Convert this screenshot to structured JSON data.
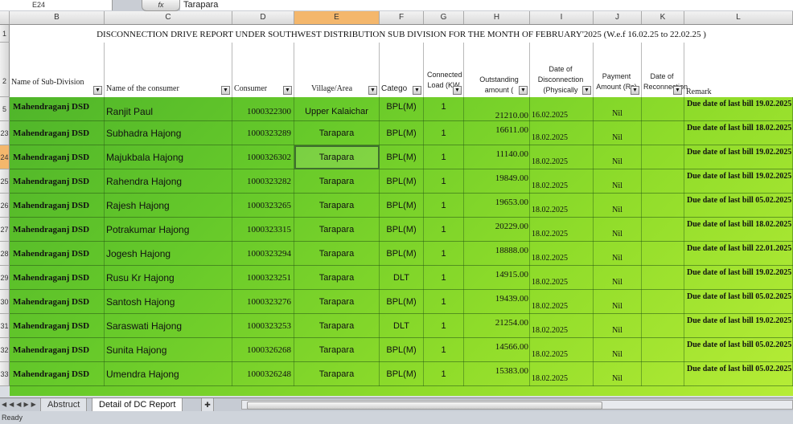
{
  "formula_bar": {
    "cell_ref": "E24",
    "fx": "fx",
    "content": "Tarapara"
  },
  "columns": [
    "B",
    "C",
    "D",
    "E",
    "F",
    "G",
    "H",
    "I",
    "J",
    "K",
    "L"
  ],
  "row_numbers": [
    "1",
    "2",
    "5",
    "23",
    "24",
    "25",
    "26",
    "27",
    "28",
    "29",
    "30",
    "31",
    "32",
    "33"
  ],
  "title": "DISCONNECTION DRIVE REPORT UNDER SOUTHWEST DISTRIBUTION SUB DIVISION FOR THE MONTH OF FEBRUARY'2025 (W.e.f 16.02.25 to 22.02.25 )",
  "headers": {
    "sub": "Name of Sub-Division",
    "name": "Name of the consumer",
    "consumer": "Consumer",
    "village": "Village/Area",
    "category": "Catego",
    "load": "Connected Load (KW",
    "outstanding": "Outstanding amount (",
    "date": "Date of Disconnection (Physically",
    "payment": "Payment Amount (Rs)",
    "reconn": "Date of Reconnection",
    "remark": "Remark"
  },
  "rows": [
    {
      "sub": "Mahendraganj DSD",
      "name": "Ranjit Paul",
      "consumer": "1000322300",
      "village": "Upper Kalaichar",
      "category": "BPL(M)",
      "load": "1",
      "amount": "21210.00",
      "date": "16.02.2025",
      "payment": "Nil",
      "remark": "Due date of last bill 19.02.2025"
    },
    {
      "sub": "Mahendraganj DSD",
      "name": "Subhadra Hajong",
      "consumer": "1000323289",
      "village": "Tarapara",
      "category": "BPL(M)",
      "load": "1",
      "amount": "16611.00",
      "date": "18.02.2025",
      "payment": "Nil",
      "remark": "Due date of last bill 18.02.2025"
    },
    {
      "sub": "Mahendraganj DSD",
      "name": "Majukbala Hajong",
      "consumer": "1000326302",
      "village": "Tarapara",
      "category": "BPL(M)",
      "load": "1",
      "amount": "11140.00",
      "date": "18.02.2025",
      "payment": "Nil",
      "remark": "Due date of last bill 19.02.2025"
    },
    {
      "sub": "Mahendraganj DSD",
      "name": "Rahendra Hajong",
      "consumer": "1000323282",
      "village": "Tarapara",
      "category": "BPL(M)",
      "load": "1",
      "amount": "19849.00",
      "date": "18.02.2025",
      "payment": "Nil",
      "remark": "Due date of last bill 19.02.2025"
    },
    {
      "sub": "Mahendraganj DSD",
      "name": "Rajesh Hajong",
      "consumer": "1000323265",
      "village": "Tarapara",
      "category": "BPL(M)",
      "load": "1",
      "amount": "19653.00",
      "date": "18.02.2025",
      "payment": "Nil",
      "remark": "Due date of last bill 05.02.2025"
    },
    {
      "sub": "Mahendraganj DSD",
      "name": "Potrakumar Hajong",
      "consumer": "1000323315",
      "village": "Tarapara",
      "category": "BPL(M)",
      "load": "1",
      "amount": "20229.00",
      "date": "18.02.2025",
      "payment": "Nil",
      "remark": "Due date of last bill 18.02.2025"
    },
    {
      "sub": "Mahendraganj DSD",
      "name": "Jogesh Hajong",
      "consumer": "1000323294",
      "village": "Tarapara",
      "category": "BPL(M)",
      "load": "1",
      "amount": "18888.00",
      "date": "18.02.2025",
      "payment": "Nil",
      "remark": "Due date of last bill 22.01.2025"
    },
    {
      "sub": "Mahendraganj DSD",
      "name": "Rusu Kr Hajong",
      "consumer": "1000323251",
      "village": "Tarapara",
      "category": "DLT",
      "load": "1",
      "amount": "14915.00",
      "date": "18.02.2025",
      "payment": "Nil",
      "remark": "Due date of last bill 19.02.2025"
    },
    {
      "sub": "Mahendraganj DSD",
      "name": "Santosh Hajong",
      "consumer": "1000323276",
      "village": "Tarapara",
      "category": "BPL(M)",
      "load": "1",
      "amount": "19439.00",
      "date": "18.02.2025",
      "payment": "Nil",
      "remark": "Due date of last bill 05.02.2025"
    },
    {
      "sub": "Mahendraganj DSD",
      "name": "Saraswati Hajong",
      "consumer": "1000323253",
      "village": "Tarapara",
      "category": "DLT",
      "load": "1",
      "amount": "21254.00",
      "date": "18.02.2025",
      "payment": "Nil",
      "remark": "Due date of last bill 19.02.2025"
    },
    {
      "sub": "Mahendraganj DSD",
      "name": "Sunita Hajong",
      "consumer": "1000326268",
      "village": "Tarapara",
      "category": "BPL(M)",
      "load": "1",
      "amount": "14566.00",
      "date": "18.02.2025",
      "payment": "Nil",
      "remark": "Due date of last bill 05.02.2025"
    },
    {
      "sub": "Mahendraganj DSD",
      "name": "Umendra Hajong",
      "consumer": "1000326248",
      "village": "Tarapara",
      "category": "BPL(M)",
      "load": "1",
      "amount": "15383.00",
      "date": "18.02.2025",
      "payment": "Nil",
      "remark": "Due date of last bill 05.02.2025"
    }
  ],
  "tabs": [
    {
      "label": "Abstruct",
      "active": false
    },
    {
      "label": "Detail of DC Report",
      "active": true
    }
  ],
  "status": "Ready",
  "colors": {
    "selected_header": "#f4b76c",
    "green_start": "#4fb52a",
    "green_end": "#b6ec36"
  }
}
